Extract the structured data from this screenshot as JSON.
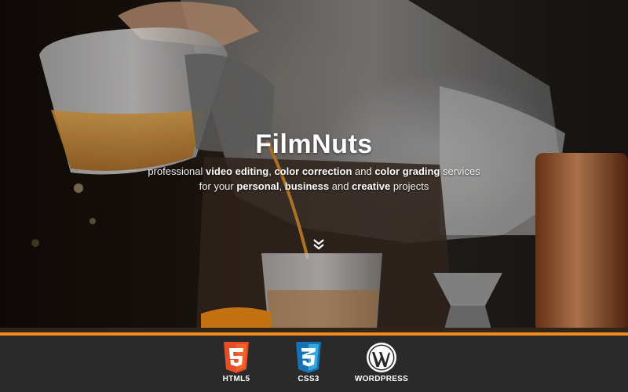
{
  "hero": {
    "brand": "FilmNuts",
    "tagline_line1": {
      "p1": "professional ",
      "b1": "video editing",
      "p2": ", ",
      "b2": "color correction",
      "p3": " and ",
      "b3": "color grading",
      "p4": " services"
    },
    "tagline_line2": {
      "p1": "for your ",
      "b1": "personal",
      "p2": ", ",
      "b2": "business",
      "p3": " and ",
      "b3": "creative",
      "p4": " projects"
    },
    "scroll_icon": "double-chevron-down-icon"
  },
  "colors": {
    "accent": "#f28c1d",
    "footer_bg": "#2a2a2a",
    "html5": "#e44d26",
    "css3": "#1572b6"
  },
  "tech_badges": [
    {
      "label": "HTML5",
      "icon": "html5-icon"
    },
    {
      "label": "CSS3",
      "icon": "css3-icon"
    },
    {
      "label": "WORDPRESS",
      "icon": "wordpress-icon"
    }
  ]
}
